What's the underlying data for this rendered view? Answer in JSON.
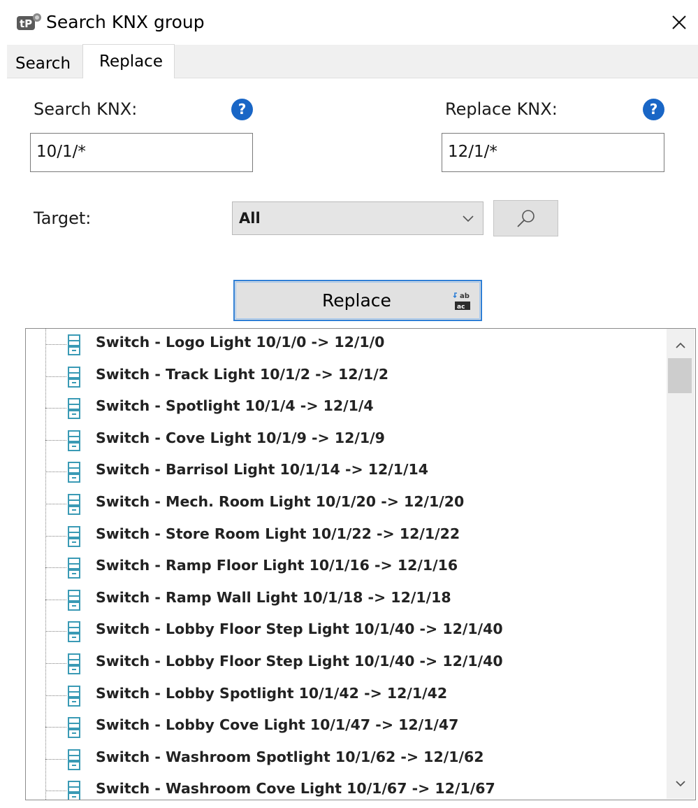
{
  "window": {
    "title": "Search KNX group",
    "app_icon": "tp-app-icon",
    "close_icon": "close-icon"
  },
  "tabs": [
    {
      "label": "Search",
      "active": false
    },
    {
      "label": "Replace",
      "active": true
    }
  ],
  "form": {
    "search_label": "Search KNX:",
    "search_value": "10/1/*",
    "replace_label": "Replace KNX:",
    "replace_value": "12/1/*",
    "help_glyph": "?",
    "target_label": "Target:",
    "target_value": "All",
    "replace_button_label": "Replace"
  },
  "colors": {
    "accent": "#2f7fd6",
    "help": "#1966c6",
    "group_icon": "#3a9ab5"
  },
  "results": [
    "Switch - Logo Light 10/1/0 -> 12/1/0",
    "Switch - Track Light 10/1/2 -> 12/1/2",
    "Switch - Spotlight 10/1/4 -> 12/1/4",
    "Switch - Cove Light 10/1/9 -> 12/1/9",
    "Switch - Barrisol Light 10/1/14 -> 12/1/14",
    "Switch - Mech. Room Light 10/1/20 -> 12/1/20",
    "Switch - Store Room Light 10/1/22 -> 12/1/22",
    "Switch - Ramp Floor Light 10/1/16 -> 12/1/16",
    "Switch - Ramp Wall Light 10/1/18 -> 12/1/18",
    "Switch - Lobby Floor Step Light 10/1/40 -> 12/1/40",
    "Switch - Lobby Floor Step Light 10/1/40 -> 12/1/40",
    "Switch - Lobby Spotlight 10/1/42 -> 12/1/42",
    "Switch - Lobby Cove Light 10/1/47 -> 12/1/47",
    "Switch - Washroom Spotlight 10/1/62 -> 12/1/62",
    "Switch - Washroom Cove Light 10/1/67 -> 12/1/67"
  ]
}
